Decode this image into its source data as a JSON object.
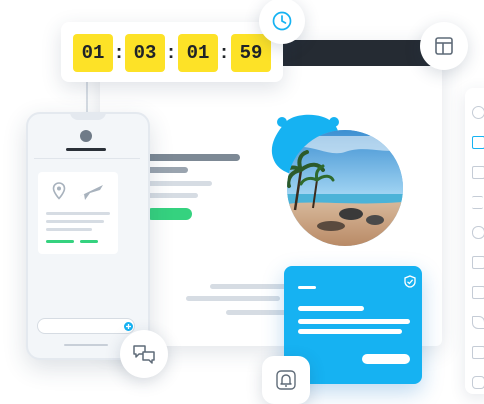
{
  "timer": {
    "hours": "01",
    "minutes": "03",
    "seconds": "01",
    "frames": "59",
    "separator": ":"
  },
  "colors": {
    "accent_blue": "#16b2f2",
    "timer_yellow": "#fde227",
    "progress_green": "#35d27f",
    "window_bar": "#252b33"
  },
  "icons": {
    "timer_badge": "clock-icon",
    "layout_button": "layout-icon",
    "chat_button": "chat-bubbles-icon",
    "notification_button": "bell-icon",
    "card_badge": "check-shield-icon",
    "phone_location": "map-pin-icon",
    "phone_flight": "airplane-icon",
    "photo_badge": "globe-blob-icon",
    "phone_send": "plus-icon"
  },
  "sidebar": {
    "items": [
      "settings-icon",
      "image-icon",
      "square-icon",
      "list-icon",
      "link-icon",
      "play-icon",
      "copy-icon",
      "pencil-icon",
      "stack-icon",
      "chat-icon"
    ],
    "active_index": 1
  }
}
